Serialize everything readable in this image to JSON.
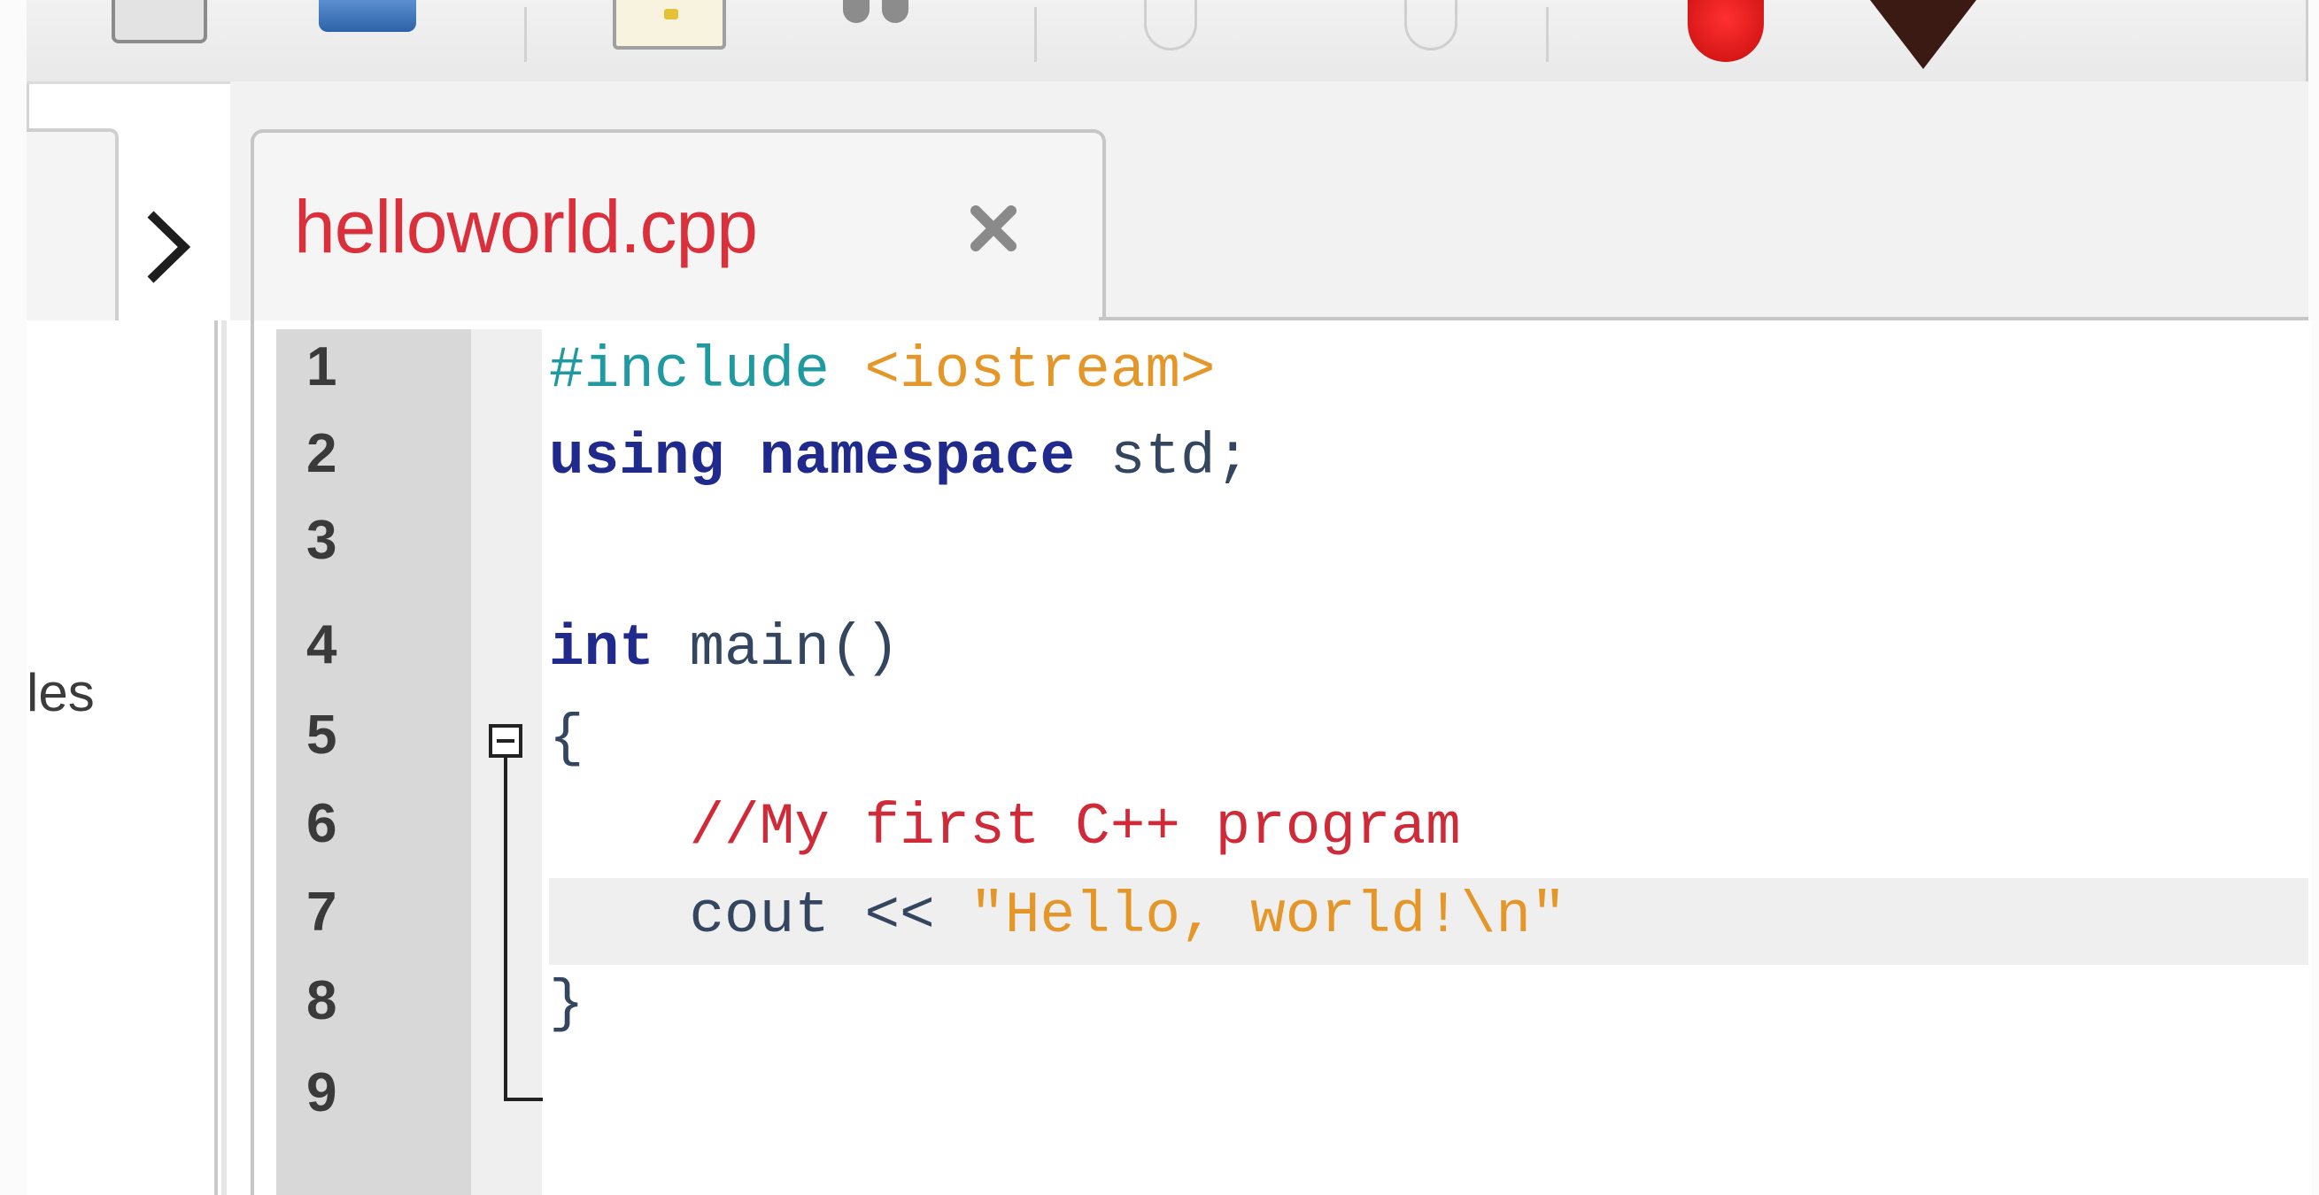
{
  "toolbar": {
    "icons": [
      "panel-icon",
      "window-icon",
      "open-file-icon",
      "view-icon",
      "undo-icon",
      "redo-icon",
      "breakpoint-icon",
      "debug-icon"
    ]
  },
  "sidebar": {
    "partial_label": "les"
  },
  "editor": {
    "tab_title": "helloworld.cpp",
    "line_numbers": [
      "1",
      "2",
      "3",
      "4",
      "5",
      "6",
      "7",
      "8",
      "9"
    ],
    "code": {
      "l1_directive": "#include",
      "l1_header": "<iostream>",
      "l2_kw1": "using",
      "l2_kw2": "namespace",
      "l2_rest": "std;",
      "l4_kw": "int",
      "l4_rest": "main()",
      "l5": "{",
      "l6_comment": "//My first C++ program",
      "l7_ident": "cout <<",
      "l7_string": "\"Hello, world!\\n\"",
      "l8": "}"
    }
  }
}
